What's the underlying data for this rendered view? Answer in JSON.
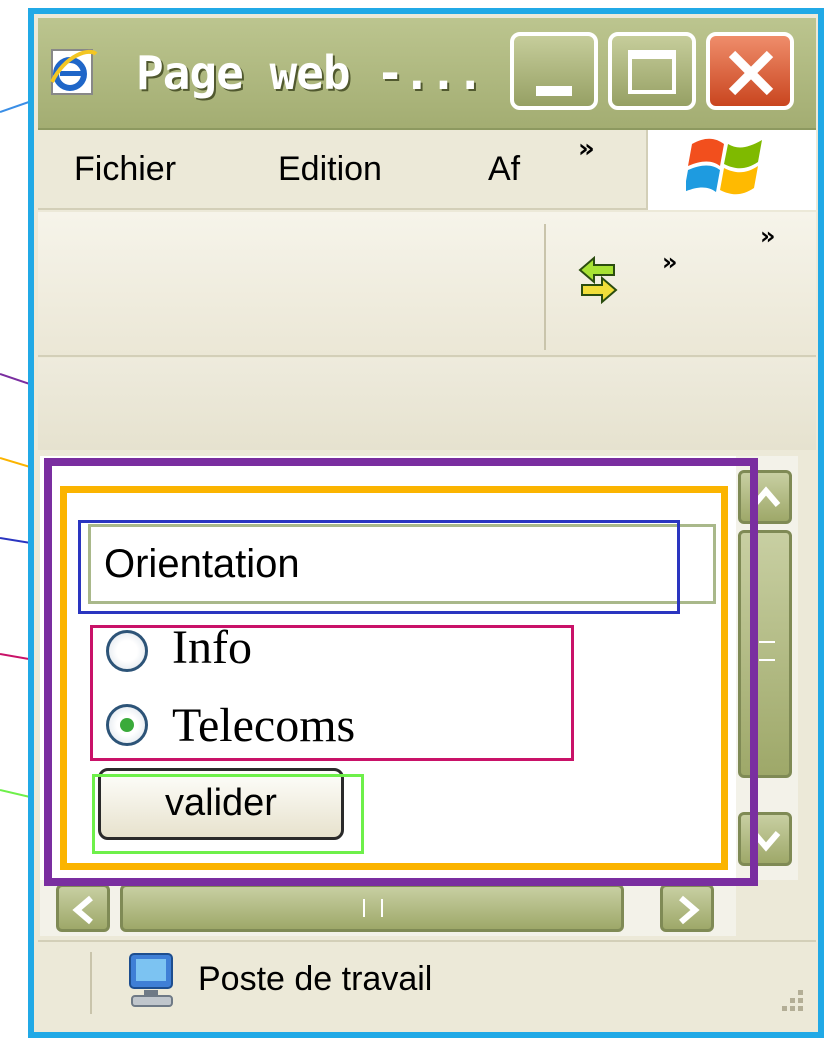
{
  "window": {
    "title": "Page web -..."
  },
  "menubar": {
    "items": [
      "Fichier",
      "Edition",
      "Af"
    ],
    "overflow": "»"
  },
  "toolbar": {
    "overflow_1": "»",
    "overflow_2": "»"
  },
  "form": {
    "legend": "Orientation",
    "options": [
      {
        "label": "Info",
        "selected": false
      },
      {
        "label": "Telecoms",
        "selected": true
      }
    ],
    "submit_label": "valider"
  },
  "statusbar": {
    "zone": "Poste de travail"
  },
  "colors": {
    "window_frame": "#21a9e6",
    "annotation_page": "#7a2ea0",
    "annotation_form": "#fbb400",
    "annotation_legend": "#2a35c0",
    "annotation_radios": "#c91268",
    "annotation_button": "#6ef04a"
  },
  "icons": [
    "ie-icon",
    "minimize-icon",
    "maximize-icon",
    "close-icon",
    "windows-logo-icon",
    "refresh-arrows-icon",
    "computer-icon",
    "resize-grip-icon",
    "scroll-up-icon",
    "scroll-down-icon",
    "scroll-left-icon",
    "scroll-right-icon"
  ]
}
